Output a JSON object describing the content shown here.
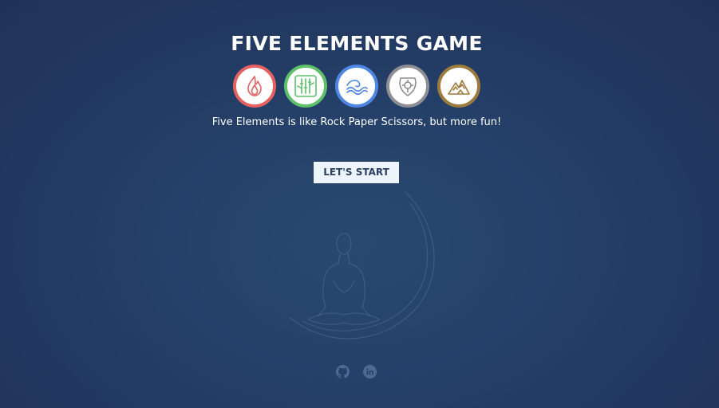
{
  "header": {
    "title": "FIVE ELEMENTS GAME"
  },
  "elements": [
    {
      "icon": "fire-icon",
      "color": "#e46161"
    },
    {
      "icon": "wood-bamboo-icon",
      "color": "#5fc06a"
    },
    {
      "icon": "water-wave-icon",
      "color": "#4f86e3"
    },
    {
      "icon": "metal-shield-icon",
      "color": "#8e8e93"
    },
    {
      "icon": "earth-mountain-icon",
      "color": "#9c7b3e"
    }
  ],
  "tagline": "Five Elements is like Rock Paper Scissors, but more fun!",
  "start_button": {
    "label": "LET'S START"
  },
  "background_art": {
    "icon": "meditation-figure-icon"
  },
  "footer": {
    "links": [
      {
        "icon": "github-icon"
      },
      {
        "icon": "linkedin-icon"
      }
    ]
  },
  "colors": {
    "background": "#25416a",
    "button_bg": "#eef4fb",
    "button_text": "#2c4064"
  }
}
